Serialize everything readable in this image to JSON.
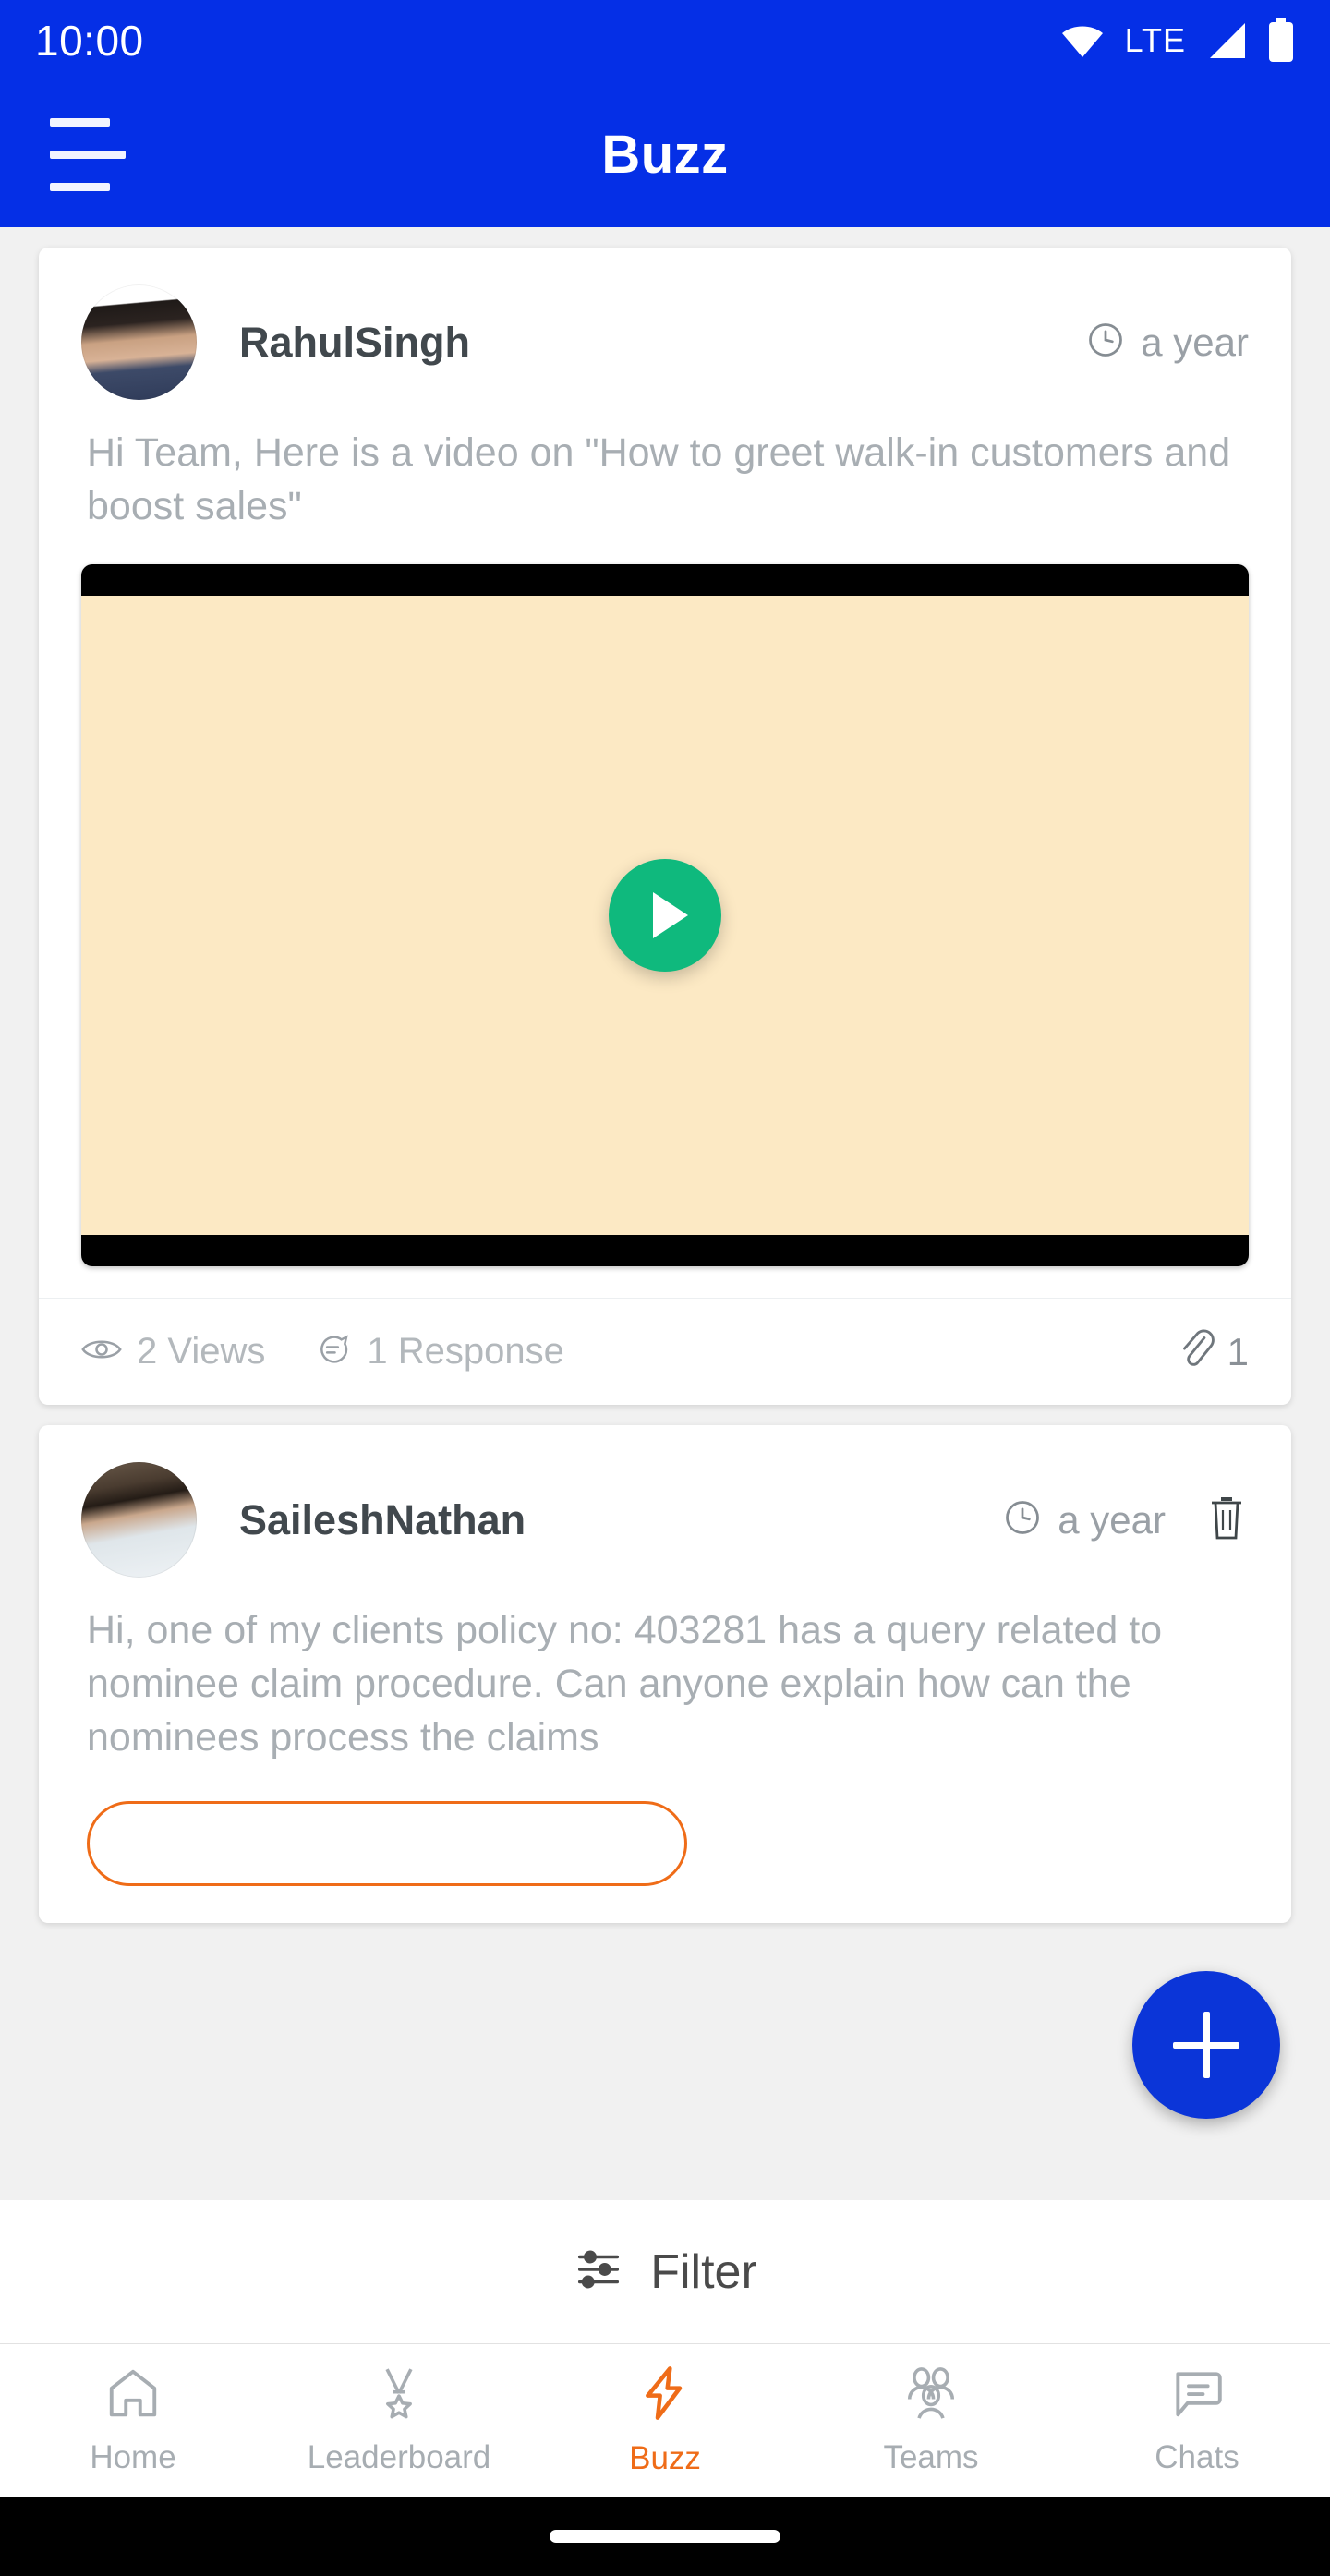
{
  "status_bar": {
    "time": "10:00",
    "network_label": "LTE",
    "icons": [
      "wifi-icon",
      "signal-icon",
      "battery-icon"
    ]
  },
  "app_bar": {
    "menu_icon": "hamburger-menu-icon",
    "title": "Buzz"
  },
  "posts": [
    {
      "author": "RahulSingh",
      "avatar": "user-avatar-rahulsingh",
      "time_icon": "clock-icon",
      "time": "a year",
      "body": "Hi Team, Here is a video on \"How to greet walk-in customers and boost sales\"",
      "media": {
        "type": "video",
        "play_icon": "play-icon",
        "thumbnail_color": "#fce9c4",
        "letterbox_color": "#000000",
        "play_button_color": "#0fb97d"
      },
      "views_icon": "eye-icon",
      "views": "2 Views",
      "responses_icon": "comment-icon",
      "responses": "1 Response",
      "attachment_icon": "paperclip-icon",
      "attachment_count": "1"
    },
    {
      "author": "SaileshNathan",
      "avatar": "user-avatar-saileshnathan",
      "time_icon": "clock-icon",
      "time": "a year",
      "delete_icon": "trash-icon",
      "body": "Hi, one of my clients policy no: 403281 has a query related to nominee claim procedure. Can anyone explain how can the nominees process the claims"
    }
  ],
  "fab": {
    "icon": "plus-icon",
    "color": "#0b35d8"
  },
  "filter_bar": {
    "icon": "filter-sliders-icon",
    "label": "Filter"
  },
  "bottom_nav": {
    "items": [
      {
        "label": "Home",
        "icon": "home-icon",
        "active": false
      },
      {
        "label": "Leaderboard",
        "icon": "medal-icon",
        "active": false
      },
      {
        "label": "Buzz",
        "icon": "lightning-icon",
        "active": true
      },
      {
        "label": "Teams",
        "icon": "people-icon",
        "active": false
      },
      {
        "label": "Chats",
        "icon": "chat-bubble-icon",
        "active": false
      }
    ],
    "active_color": "#ef6c18",
    "inactive_color": "#a7adb2"
  },
  "system_nav": {
    "gesture_bar": "gesture-pill"
  },
  "theme": {
    "primary_blue": "#052FE6",
    "accent_orange": "#ef6c18",
    "muted_text": "#a8aeb3"
  }
}
